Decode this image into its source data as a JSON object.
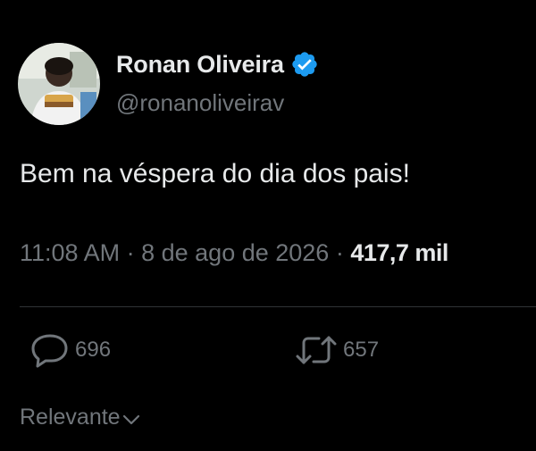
{
  "author": {
    "display_name": "Ronan Oliveira",
    "handle": "@ronanoliveirav",
    "verified_icon": "verified-badge-icon",
    "verified_color": "#1d9bf0"
  },
  "tweet": {
    "text": "Bem na véspera do dia dos pais!",
    "time": "11:08 AM",
    "separator": "·",
    "date": "8 de ago de 2026",
    "views": "417,7 mil"
  },
  "actions": {
    "reply": {
      "icon": "reply-icon",
      "count": "696"
    },
    "retweet": {
      "icon": "retweet-icon",
      "count": "657"
    }
  },
  "sort": {
    "label": "Relevante",
    "icon": "chevron-down-icon"
  },
  "colors": {
    "background": "#000000",
    "primary_text": "#e7e9ea",
    "secondary_text": "#71767b",
    "divider": "#2f3336"
  }
}
